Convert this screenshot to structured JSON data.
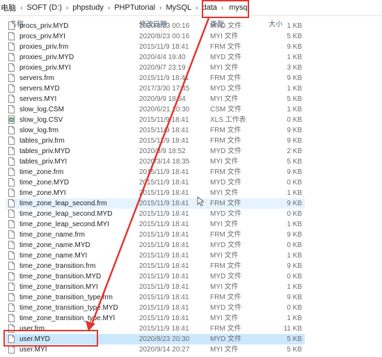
{
  "breadcrumb": {
    "items": [
      "电脑",
      "SOFT (D:)",
      "phpstudy",
      "PHPTutorial",
      "MySQL",
      "data"
    ],
    "current": "mysql"
  },
  "columns": {
    "name": "名称",
    "date": "修改日期",
    "type": "类型",
    "size": "大小"
  },
  "files": [
    {
      "name": "procs_priv.MYD",
      "date": "2020/8/23 00:16",
      "type": "MYD 文件",
      "size": "1 KB",
      "icon": "file-icon"
    },
    {
      "name": "procs_priv.MYI",
      "date": "2020/8/23 00:16",
      "type": "MYI 文件",
      "size": "5 KB",
      "icon": "file-icon"
    },
    {
      "name": "proxies_priv.frm",
      "date": "2015/11/9 18:41",
      "type": "FRM 文件",
      "size": "9 KB",
      "icon": "file-icon"
    },
    {
      "name": "proxies_priv.MYD",
      "date": "2020/4/4 19:40",
      "type": "MYD 文件",
      "size": "1 KB",
      "icon": "file-icon"
    },
    {
      "name": "proxies_priv.MYI",
      "date": "2020/9/7 23:19",
      "type": "MYI 文件",
      "size": "3 KB",
      "icon": "file-icon"
    },
    {
      "name": "servers.frm",
      "date": "2015/11/9 18:41",
      "type": "FRM 文件",
      "size": "9 KB",
      "icon": "file-icon"
    },
    {
      "name": "servers.MYD",
      "date": "2017/3/30 17:45",
      "type": "MYD 文件",
      "size": "1 KB",
      "icon": "file-icon"
    },
    {
      "name": "servers.MYI",
      "date": "2020/9/9 18:54",
      "type": "MYI 文件",
      "size": "5 KB",
      "icon": "file-icon"
    },
    {
      "name": "slow_log.CSM",
      "date": "2020/6/21 20:30",
      "type": "CSM 文件",
      "size": "1 KB",
      "icon": "file-icon"
    },
    {
      "name": "slow_log.CSV",
      "date": "2015/11/9 18:41",
      "type": "XLS 工作表",
      "size": "0 KB",
      "icon": "spreadsheet-icon"
    },
    {
      "name": "slow_log.frm",
      "date": "2015/11/9 18:41",
      "type": "FRM 文件",
      "size": "9 KB",
      "icon": "file-icon"
    },
    {
      "name": "tables_priv.frm",
      "date": "2015/11/9 18:41",
      "type": "FRM 文件",
      "size": "9 KB",
      "icon": "file-icon"
    },
    {
      "name": "tables_priv.MYD",
      "date": "2020/8/9 18:52",
      "type": "MYD 文件",
      "size": "2 KB",
      "icon": "file-icon"
    },
    {
      "name": "tables_priv.MYI",
      "date": "2020/3/14 18:35",
      "type": "MYI 文件",
      "size": "5 KB",
      "icon": "file-icon"
    },
    {
      "name": "time_zone.frm",
      "date": "2015/11/9 18:41",
      "type": "FRM 文件",
      "size": "9 KB",
      "icon": "file-icon"
    },
    {
      "name": "time_zone.MYD",
      "date": "2015/11/9 18:41",
      "type": "MYD 文件",
      "size": "0 KB",
      "icon": "file-icon"
    },
    {
      "name": "time_zone.MYI",
      "date": "2015/11/9 18:41",
      "type": "MYI 文件",
      "size": "1 KB",
      "icon": "file-icon"
    },
    {
      "name": "time_zone_leap_second.frm",
      "date": "2015/11/9 18:41",
      "type": "FRM 文件",
      "size": "9 KB",
      "icon": "file-icon"
    },
    {
      "name": "time_zone_leap_second.MYD",
      "date": "2015/11/9 18:41",
      "type": "MYD 文件",
      "size": "0 KB",
      "icon": "file-icon"
    },
    {
      "name": "time_zone_leap_second.MYI",
      "date": "2015/11/9 18:41",
      "type": "MYI 文件",
      "size": "1 KB",
      "icon": "file-icon"
    },
    {
      "name": "time_zone_name.frm",
      "date": "2015/11/9 18:41",
      "type": "FRM 文件",
      "size": "9 KB",
      "icon": "file-icon"
    },
    {
      "name": "time_zone_name.MYD",
      "date": "2015/11/9 18:41",
      "type": "MYD 文件",
      "size": "0 KB",
      "icon": "file-icon"
    },
    {
      "name": "time_zone_name.MYI",
      "date": "2015/11/9 18:41",
      "type": "MYI 文件",
      "size": "1 KB",
      "icon": "file-icon"
    },
    {
      "name": "time_zone_transition.frm",
      "date": "2015/11/9 18:41",
      "type": "FRM 文件",
      "size": "9 KB",
      "icon": "file-icon"
    },
    {
      "name": "time_zone_transition.MYD",
      "date": "2015/11/9 18:41",
      "type": "MYD 文件",
      "size": "0 KB",
      "icon": "file-icon"
    },
    {
      "name": "time_zone_transition.MYI",
      "date": "2015/11/9 18:41",
      "type": "MYI 文件",
      "size": "1 KB",
      "icon": "file-icon"
    },
    {
      "name": "time_zone_transition_type.frm",
      "date": "2015/11/9 18:41",
      "type": "FRM 文件",
      "size": "9 KB",
      "icon": "file-icon"
    },
    {
      "name": "time_zone_transition_type.MYD",
      "date": "2015/11/9 18:41",
      "type": "MYD 文件",
      "size": "0 KB",
      "icon": "file-icon"
    },
    {
      "name": "time_zone_transition_type.MYI",
      "date": "2015/11/9 18:41",
      "type": "MYI 文件",
      "size": "1 KB",
      "icon": "file-icon"
    },
    {
      "name": "user.frm",
      "date": "2015/11/9 18:41",
      "type": "FRM 文件",
      "size": "11 KB",
      "icon": "file-icon"
    },
    {
      "name": "user.MYD",
      "date": "2020/8/23 20:30",
      "type": "MYD 文件",
      "size": "5 KB",
      "icon": "file-icon",
      "selected": true
    },
    {
      "name": "user.MYI",
      "date": "2020/9/14 20:27",
      "type": "MYI 文件",
      "size": "5 KB",
      "icon": "file-icon"
    }
  ],
  "hover_row": "time_zone_leap_second.frm",
  "annotation_color": "#e3342f"
}
